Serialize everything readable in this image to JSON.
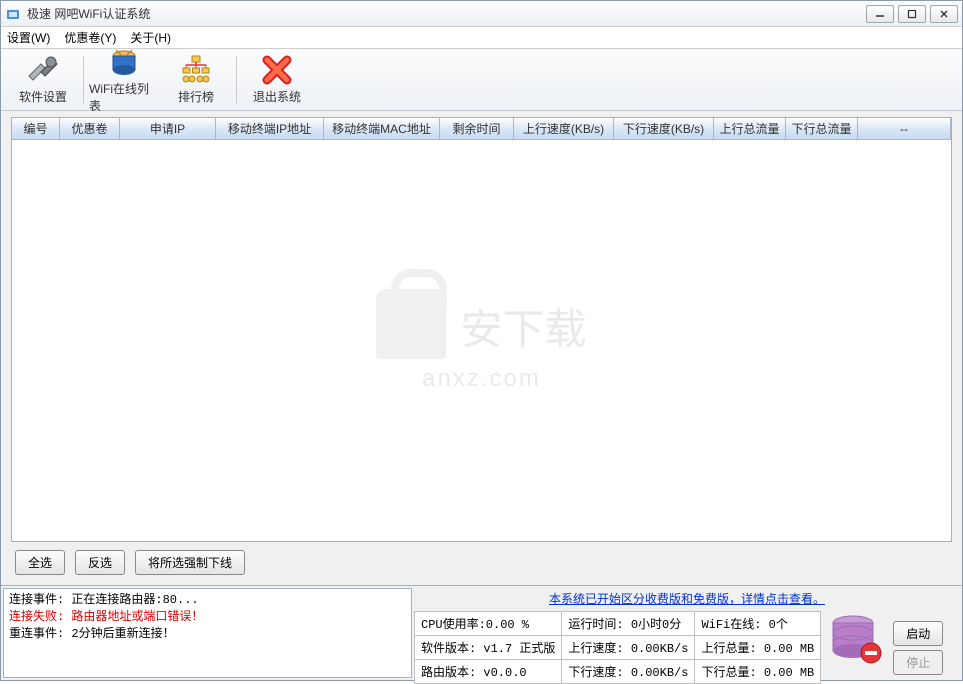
{
  "window": {
    "title": "极速 网吧WiFi认证系统"
  },
  "menu": {
    "settings": "设置(W)",
    "coupon": "优惠卷(Y)",
    "about": "关于(H)"
  },
  "toolbar": {
    "settings": "软件设置",
    "wifi_list": "WiFi在线列表",
    "ranking": "排行榜",
    "exit": "退出系统"
  },
  "columns": {
    "c0": "编号",
    "c1": "优惠卷",
    "c2": "申请IP",
    "c3": "移动终端IP地址",
    "c4": "移动终端MAC地址",
    "c5": "剩余时间",
    "c6": "上行速度(KB/s)",
    "c7": "下行速度(KB/s)",
    "c8": "上行总流量",
    "c9": "下行总流量",
    "c10": "--"
  },
  "watermark": {
    "line1": "安下载",
    "line2": "anxz.com"
  },
  "actions": {
    "select_all": "全选",
    "invert": "反选",
    "force_offline": "将所选强制下线"
  },
  "log": {
    "l1": "连接事件: 正在连接路由器:80...",
    "l2": "连接失败: 路由器地址或端口错误！",
    "l3": "重连事件: 2分钟后重新连接！"
  },
  "notice": "本系统已开始区分收费版和免费版，详情点击查看。",
  "stats": {
    "r1c1": "CPU使用率:0.00 %",
    "r1c2": "运行时间: 0小时0分",
    "r1c3": "WiFi在线: 0个",
    "r2c1": "软件版本: v1.7 正式版",
    "r2c2": "上行速度: 0.00KB/s",
    "r2c3": "上行总量: 0.00 MB",
    "r3c1": "路由版本: v0.0.0",
    "r3c2": "下行速度: 0.00KB/s",
    "r3c3": "下行总量: 0.00 MB"
  },
  "buttons": {
    "start": "启动",
    "stop": "停止"
  }
}
